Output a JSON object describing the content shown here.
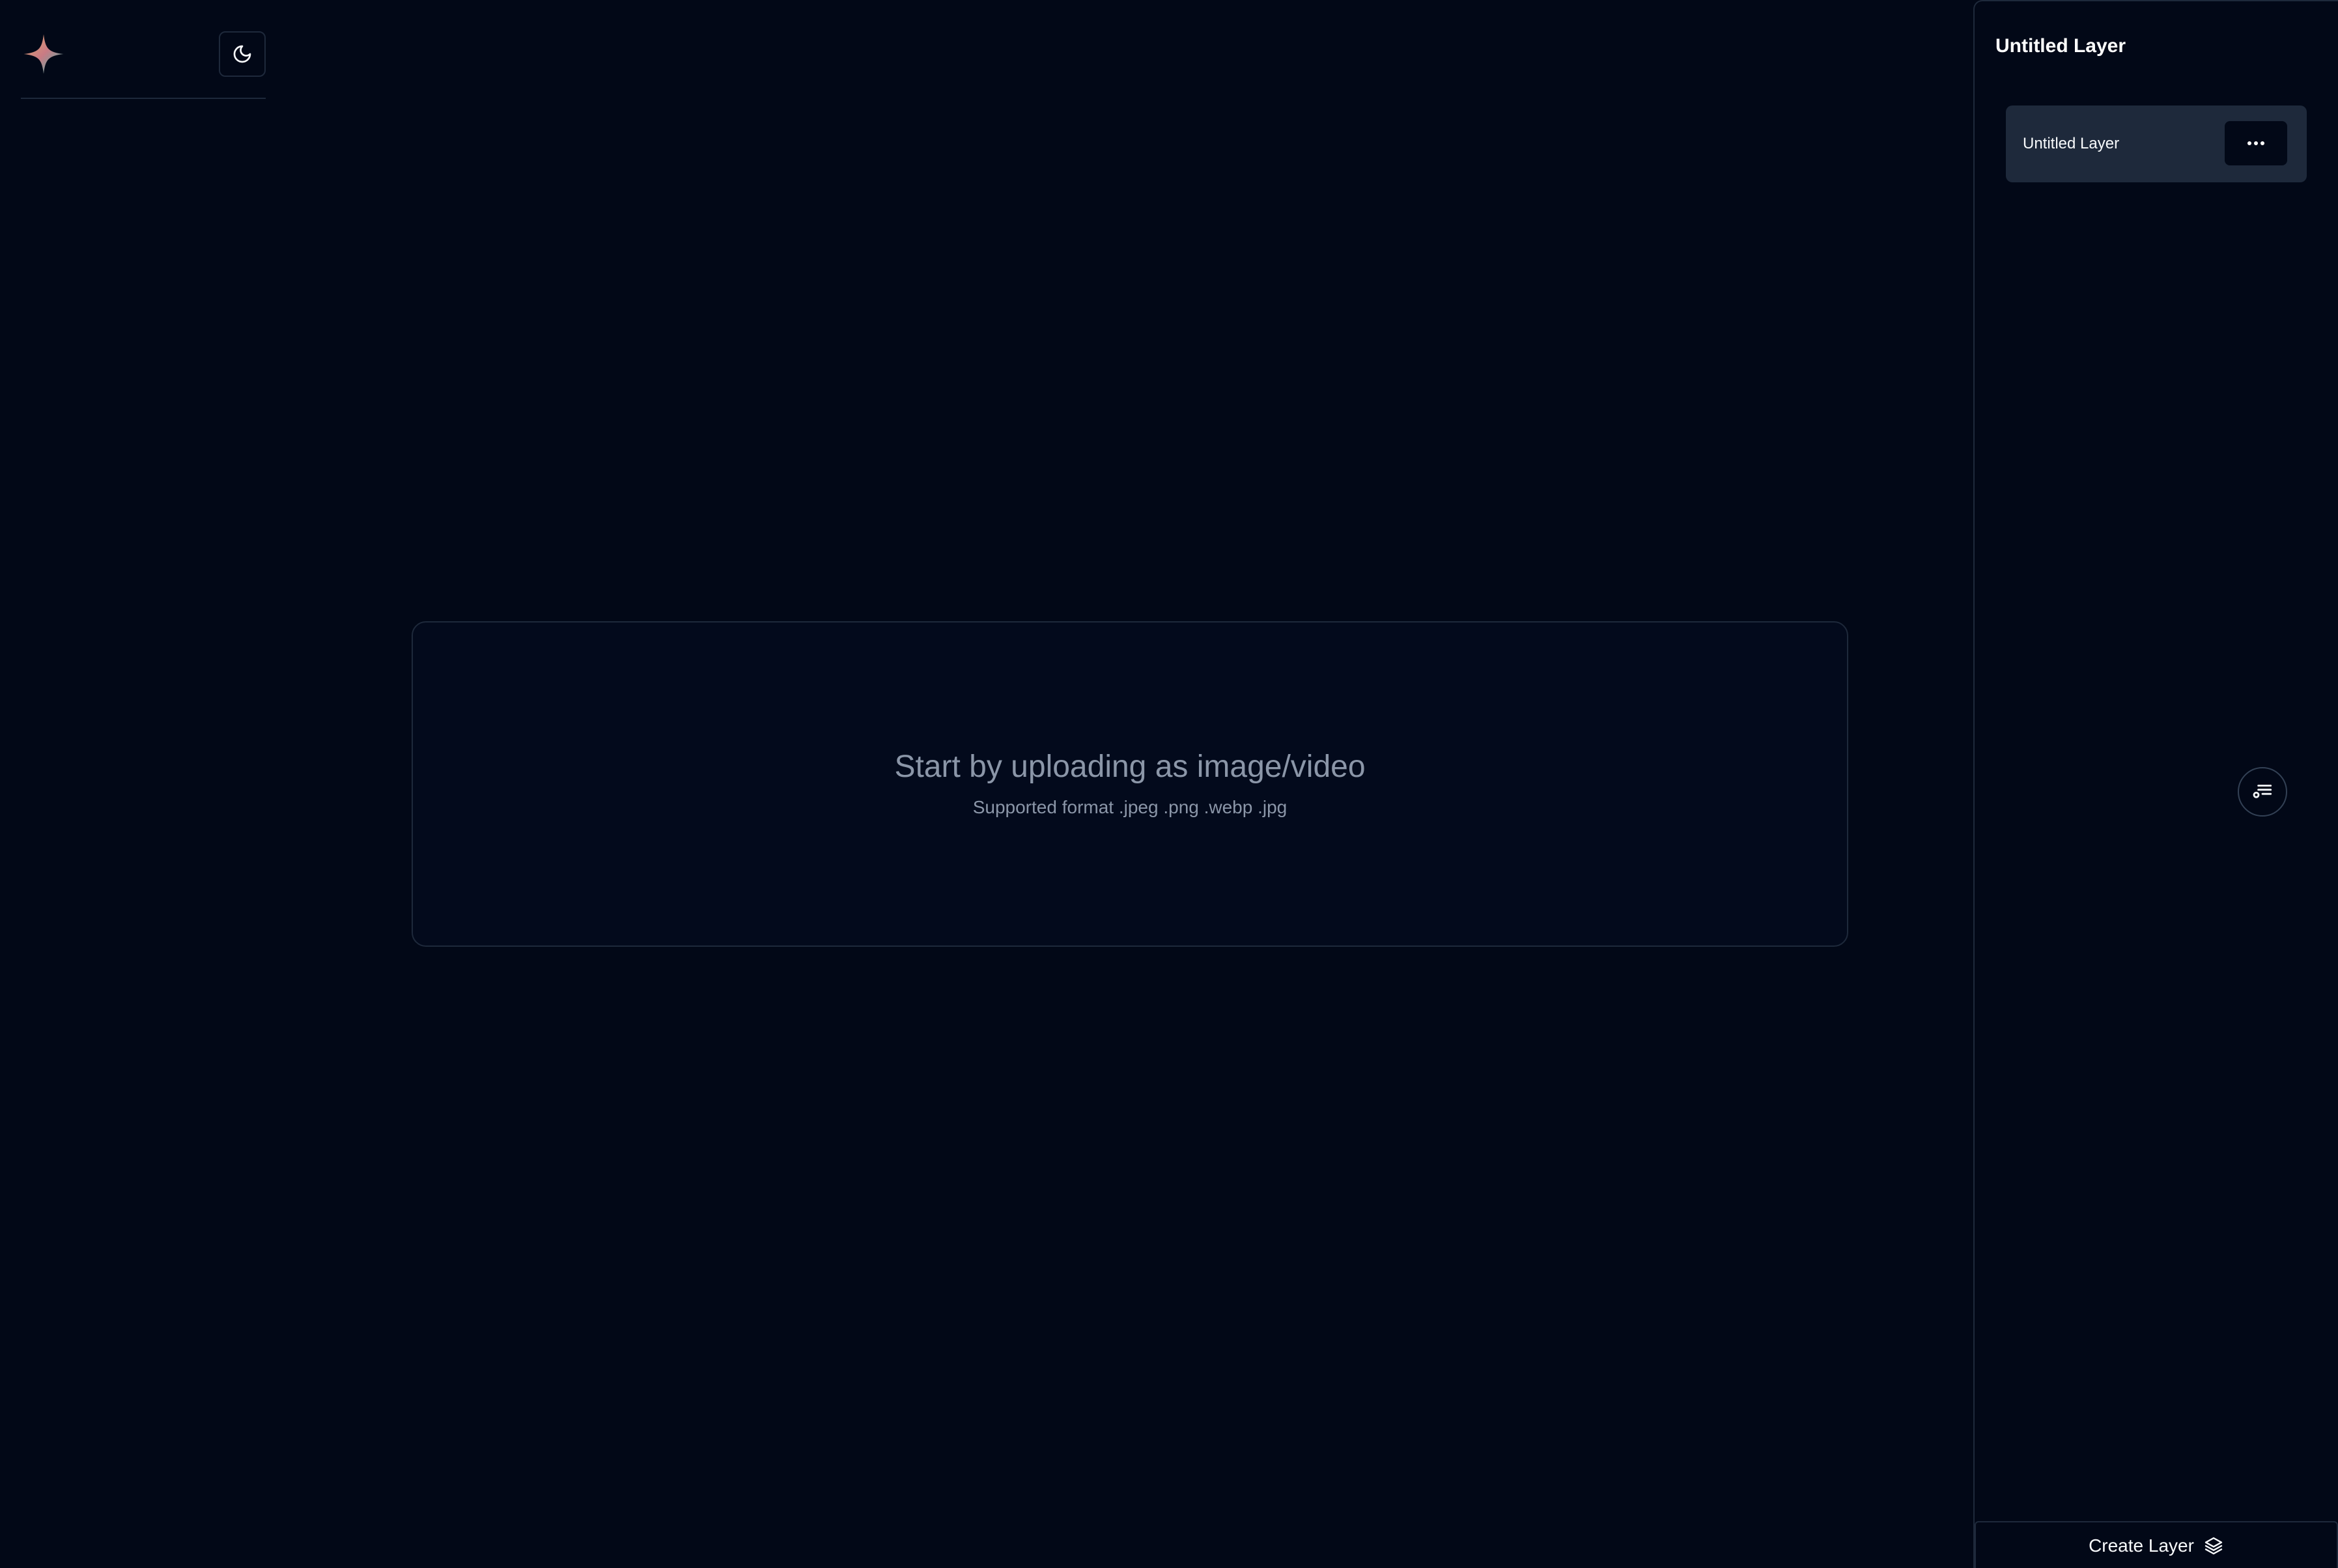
{
  "header": {
    "logo_icon": "sparkle-star-icon",
    "theme_toggle_icon": "moon-icon"
  },
  "upload": {
    "title": "Start by uploading as image/video",
    "subtitle": "Supported format .jpeg .png .webp .jpg"
  },
  "panel": {
    "title": "Untitled Layer",
    "layers": [
      {
        "label": "Untitled Layer",
        "menu_icon": "more-horizontal-icon"
      }
    ],
    "filter_icon": "filter-settings-icon",
    "create_button_label": "Create Layer",
    "create_button_icon": "layers-icon"
  },
  "colors": {
    "background": "#020817",
    "border": "#1e293b",
    "card": "#1e293b",
    "muted_text": "#8b96a8",
    "text": "#f8fafc"
  }
}
